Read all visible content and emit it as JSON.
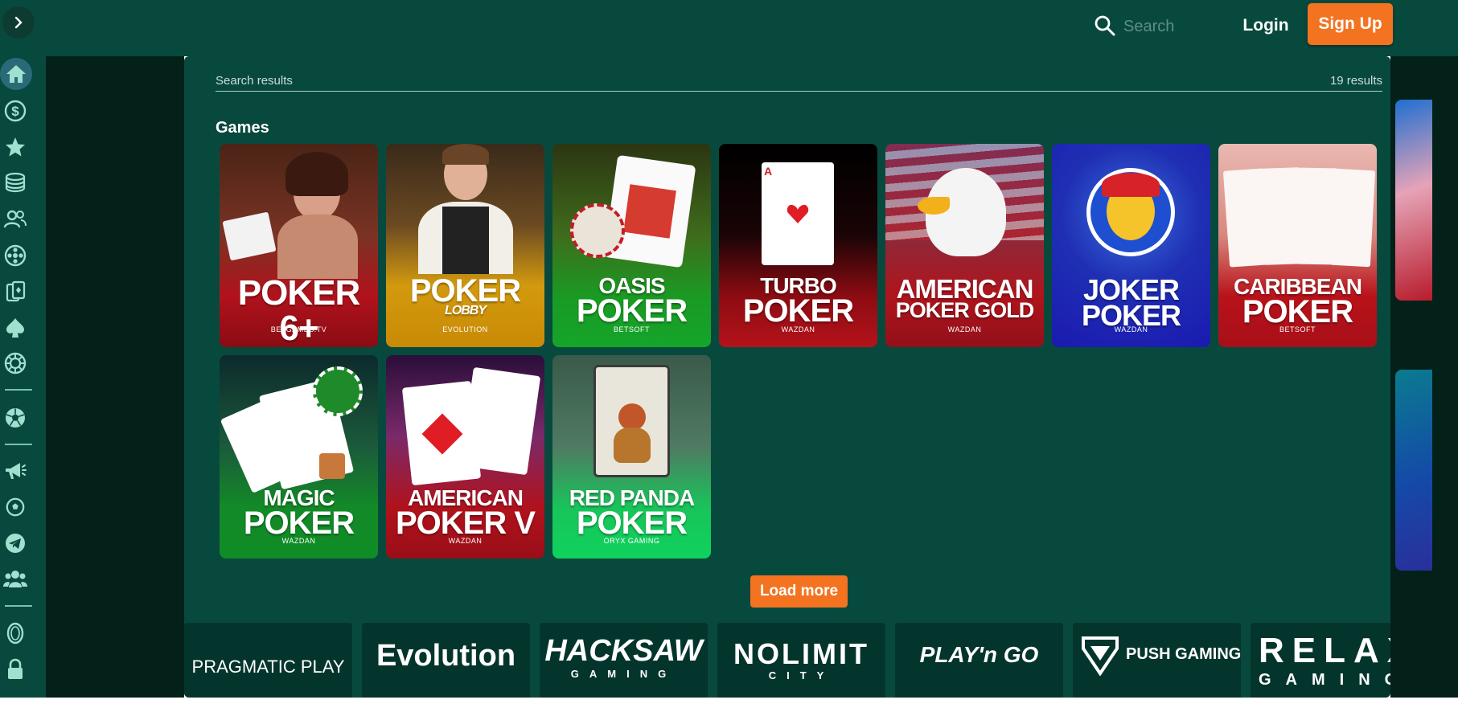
{
  "header": {
    "search_placeholder": "Search",
    "login_label": "Login",
    "signup_label": "Sign Up"
  },
  "sidebar": {
    "toggle_icon": "chevron-right-icon",
    "items": [
      {
        "icon": "home-icon",
        "active": true
      },
      {
        "icon": "dollar-icon"
      },
      {
        "icon": "star-icon"
      },
      {
        "icon": "coins-stack-icon"
      },
      {
        "icon": "users-icon"
      },
      {
        "icon": "film-reel-icon"
      },
      {
        "icon": "cards-icon"
      },
      {
        "icon": "spade-icon"
      },
      {
        "icon": "roulette-icon"
      },
      {
        "icon": "soccer-ball-icon"
      },
      {
        "icon": "megaphone-icon"
      },
      {
        "icon": "football-icon"
      },
      {
        "icon": "telegram-icon"
      },
      {
        "icon": "group-icon"
      },
      {
        "icon": "coin-icon"
      },
      {
        "icon": "lock-icon"
      }
    ]
  },
  "results": {
    "label": "Search results",
    "count": "19 results"
  },
  "games_heading": "Games",
  "games": [
    {
      "line1": "POKER 6+",
      "line2": "",
      "provider": "BETGAMES.TV"
    },
    {
      "line1": "POKER",
      "line2": "LOBBY",
      "provider": "EVOLUTION"
    },
    {
      "line1": "OASIS",
      "line2": "POKER",
      "provider": "BETSOFT"
    },
    {
      "line1": "TURBO",
      "line2": "POKER",
      "provider": "WAZDAN"
    },
    {
      "line1": "AMERICAN",
      "line2": "POKER GOLD",
      "provider": "WAZDAN"
    },
    {
      "line1": "JOKER",
      "line2": "POKER",
      "provider": "WAZDAN"
    },
    {
      "line1": "CARIBBEAN",
      "line2": "POKER",
      "provider": "BETSOFT"
    },
    {
      "line1": "MAGIC",
      "line2": "POKER",
      "provider": "WAZDAN"
    },
    {
      "line1": "AMERICAN",
      "line2": "POKER V",
      "provider": "WAZDAN"
    },
    {
      "line1": "RED PANDA",
      "line2": "POKER",
      "provider": "ORYX GAMING"
    }
  ],
  "load_more_label": "Load more",
  "providers": [
    {
      "name": "PRAGMATIC PLAY",
      "sub": ""
    },
    {
      "name": "Evolution",
      "sub": ""
    },
    {
      "name": "HACKSAW",
      "sub": "GAMING"
    },
    {
      "name": "NOLIMIT",
      "sub": "CITY"
    },
    {
      "name": "PLAY'n GO",
      "sub": ""
    },
    {
      "name": "PUSH GAMING",
      "sub": ""
    },
    {
      "name": "RELAX",
      "sub": "GAMING"
    }
  ],
  "colors": {
    "brand_green": "#08493d",
    "dark_bg": "#032119",
    "accent_orange": "#f37321"
  }
}
